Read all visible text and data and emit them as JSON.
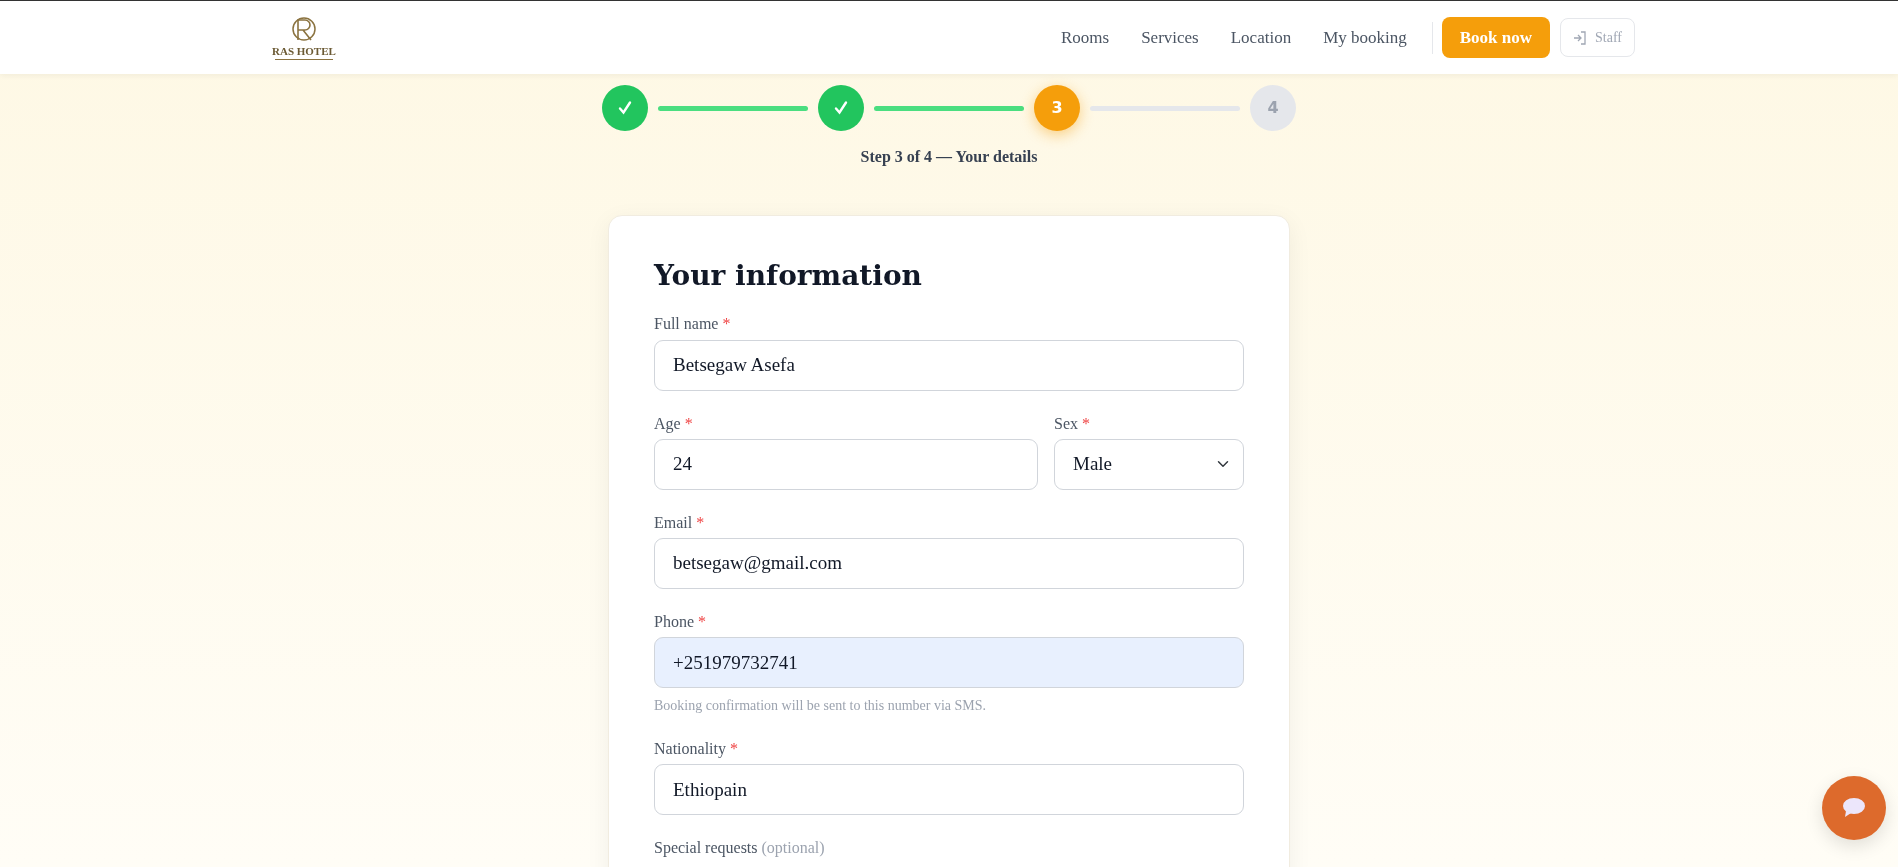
{
  "header": {
    "logo_text": "RAS HOTEL",
    "nav": [
      {
        "label": "Rooms"
      },
      {
        "label": "Services"
      },
      {
        "label": "Location"
      },
      {
        "label": "My booking"
      }
    ],
    "book_button": "Book now",
    "staff_button": "Staff"
  },
  "stepper": {
    "steps": [
      {
        "done": true,
        "selected": false
      },
      {
        "done": true,
        "selected": false
      },
      {
        "label": "3",
        "done": false,
        "selected": true
      },
      {
        "label": "4",
        "done": false,
        "selected": false
      }
    ],
    "caption": "Step 3 of 4 — Your details"
  },
  "form": {
    "title": "Your information",
    "rows": [
      {
        "fields": [
          {
            "kind": "input",
            "label": "Full name",
            "required_mark": "*",
            "value": "Betsegaw Asefa",
            "autofilled": false
          }
        ]
      },
      {
        "fields": [
          {
            "kind": "input",
            "label": "Age",
            "required_mark": "*",
            "value": "24",
            "autofilled": false
          },
          {
            "kind": "select",
            "label": "Sex",
            "required_mark": "*",
            "value": "Male",
            "autofilled": false
          }
        ]
      },
      {
        "fields": [
          {
            "kind": "input",
            "label": "Email",
            "required_mark": "*",
            "value": "betsegaw@gmail.com",
            "autofilled": false
          }
        ]
      },
      {
        "fields": [
          {
            "kind": "input",
            "label": "Phone",
            "required_mark": "*",
            "value": "+251979732741",
            "autofilled": true,
            "help": "Booking confirmation will be sent to this number via SMS."
          }
        ]
      },
      {
        "fields": [
          {
            "kind": "input",
            "label": "Nationality",
            "required_mark": "*",
            "value": "Ethiopain",
            "autofilled": false
          }
        ]
      },
      {
        "fields": [
          {
            "kind": "label_only",
            "label": "Special requests",
            "optional_note": "(optional)"
          }
        ]
      }
    ]
  }
}
